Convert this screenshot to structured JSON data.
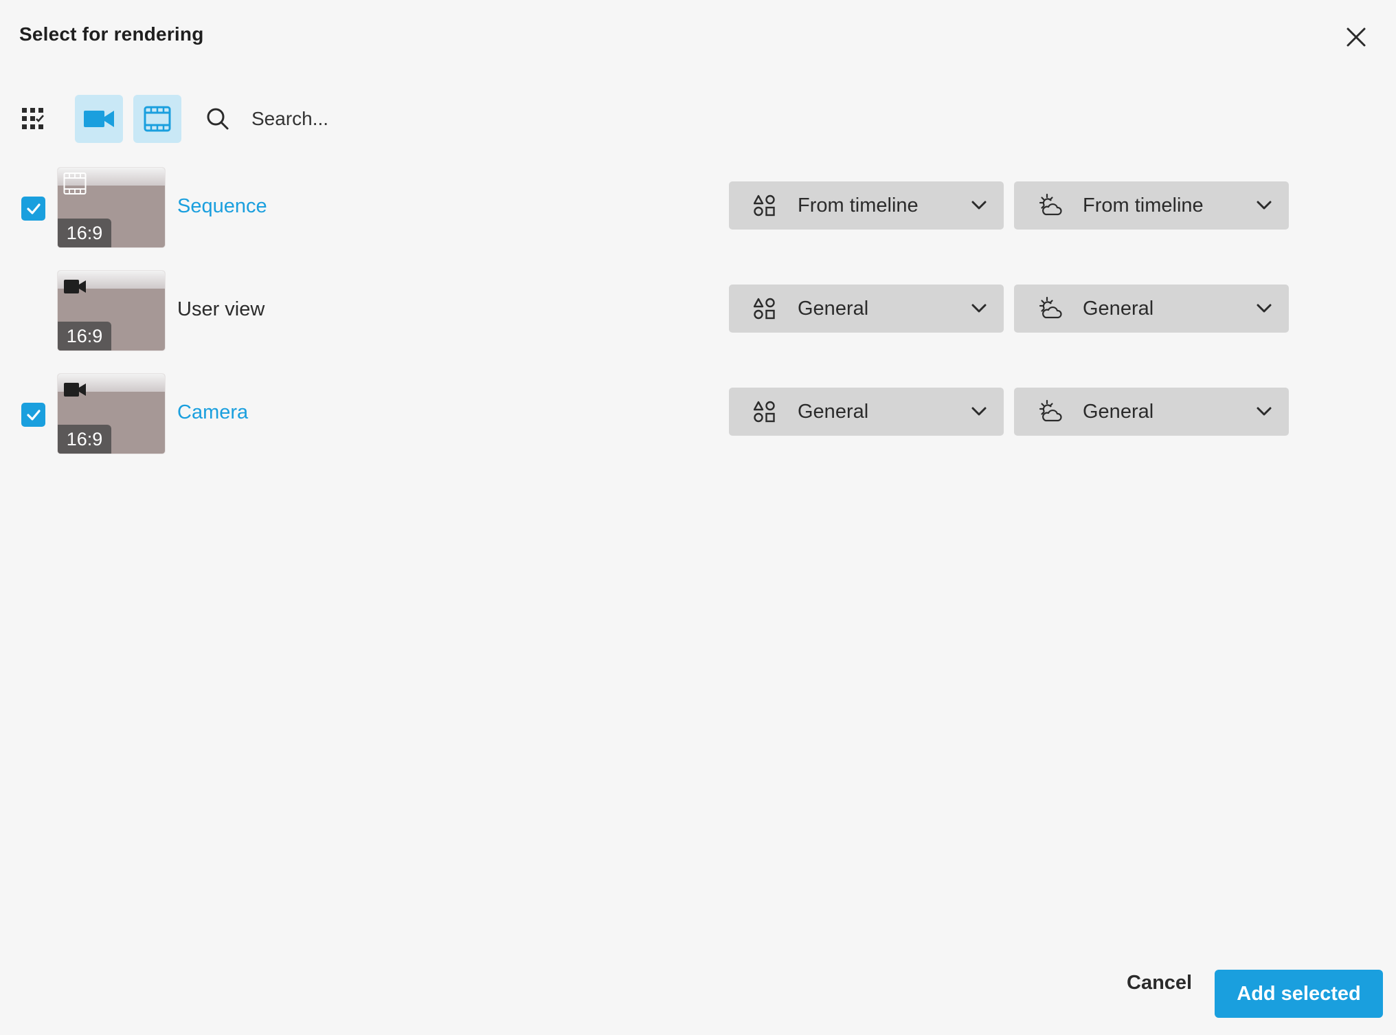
{
  "dialog": {
    "title": "Select for rendering",
    "close_icon": "close-icon"
  },
  "toolbar": {
    "filters": [
      {
        "name": "select-all-grid-icon",
        "active": false
      },
      {
        "name": "camera-filter-icon",
        "active": true
      },
      {
        "name": "sequence-filter-icon",
        "active": true
      }
    ],
    "search": {
      "placeholder": "Search...",
      "value": ""
    }
  },
  "items": [
    {
      "name": "Sequence",
      "type_icon": "film-strip-icon",
      "checked": true,
      "aspect_ratio": "16:9",
      "style_setting": "From timeline",
      "environment_setting": "From timeline"
    },
    {
      "name": "User view",
      "type_icon": "video-camera-icon",
      "checked": false,
      "aspect_ratio": "16:9",
      "style_setting": "General",
      "environment_setting": "General"
    },
    {
      "name": "Camera",
      "type_icon": "video-camera-icon",
      "checked": true,
      "aspect_ratio": "16:9",
      "style_setting": "General",
      "environment_setting": "General"
    }
  ],
  "footer": {
    "cancel_label": "Cancel",
    "add_label": "Add selected"
  },
  "colors": {
    "accent": "#1a9fde",
    "active_filter_bg": "#c9e8f6",
    "dropdown_bg": "#d5d5d5",
    "background": "#f6f6f6"
  }
}
